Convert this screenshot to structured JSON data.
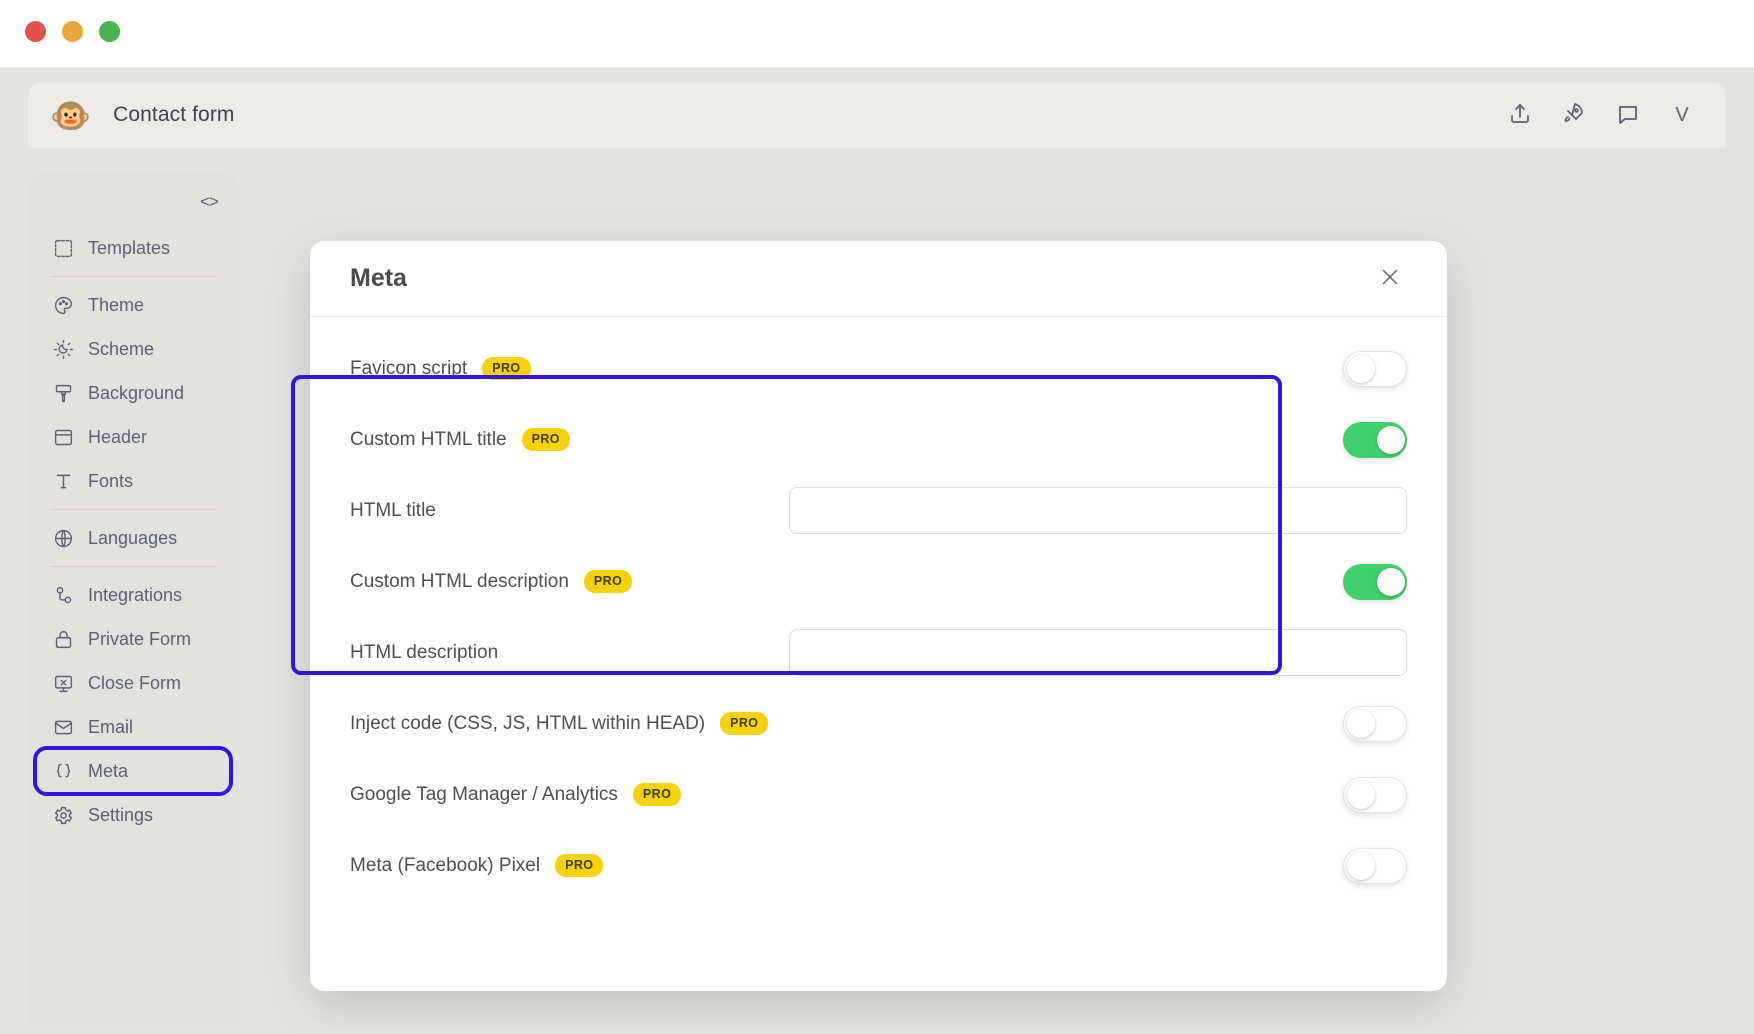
{
  "window": {
    "traffic_lights": [
      "close",
      "minimize",
      "zoom"
    ]
  },
  "topbar": {
    "logo_glyph": "🐵",
    "title": "Contact form",
    "actions": [
      {
        "name": "share-upload",
        "icon": "upload-icon"
      },
      {
        "name": "publish",
        "icon": "rocket-icon"
      },
      {
        "name": "comments",
        "icon": "chat-bubble-icon"
      }
    ],
    "avatar_initial": "V"
  },
  "sidebar": {
    "code_toggle": "<>",
    "items": [
      {
        "label": "Templates",
        "icon": "templates-icon",
        "divider_after": true,
        "selected": false
      },
      {
        "label": "Theme",
        "icon": "palette-icon",
        "divider_after": false,
        "selected": false
      },
      {
        "label": "Scheme",
        "icon": "sun-moon-icon",
        "divider_after": false,
        "selected": false
      },
      {
        "label": "Background",
        "icon": "paint-brush-icon",
        "divider_after": false,
        "selected": false
      },
      {
        "label": "Header",
        "icon": "layout-icon",
        "divider_after": false,
        "selected": false
      },
      {
        "label": "Fonts",
        "icon": "text-t-icon",
        "divider_after": true,
        "selected": false
      },
      {
        "label": "Languages",
        "icon": "globe-icon",
        "divider_after": true,
        "selected": false
      },
      {
        "label": "Integrations",
        "icon": "nodes-icon",
        "divider_after": false,
        "selected": false
      },
      {
        "label": "Private Form",
        "icon": "lock-icon",
        "divider_after": false,
        "selected": false
      },
      {
        "label": "Close Form",
        "icon": "monitor-x-icon",
        "divider_after": false,
        "selected": false
      },
      {
        "label": "Email",
        "icon": "envelope-icon",
        "divider_after": false,
        "selected": false
      },
      {
        "label": "Meta",
        "icon": "curly-braces-icon",
        "divider_after": false,
        "selected": true
      },
      {
        "label": "Settings",
        "icon": "gear-icon",
        "divider_after": false,
        "selected": false
      }
    ]
  },
  "modal": {
    "title": "Meta",
    "close_glyph": "×",
    "rows": [
      {
        "label": "Favicon script",
        "pro": "PRO",
        "control": "toggle",
        "toggle_on": false
      },
      {
        "label": "Custom HTML title",
        "pro": "PRO",
        "control": "toggle",
        "toggle_on": true
      },
      {
        "label": "HTML title",
        "pro": "",
        "control": "input",
        "value": "",
        "placeholder": ""
      },
      {
        "label": "Custom HTML description",
        "pro": "PRO",
        "control": "toggle",
        "toggle_on": true
      },
      {
        "label": "HTML description",
        "pro": "",
        "control": "input",
        "value": "",
        "placeholder": ""
      },
      {
        "label": "Inject code (CSS, JS, HTML within HEAD)",
        "pro": "PRO",
        "control": "toggle",
        "toggle_on": false
      },
      {
        "label": "Google Tag Manager / Analytics",
        "pro": "PRO",
        "control": "toggle",
        "toggle_on": false
      },
      {
        "label": "Meta (Facebook) Pixel",
        "pro": "PRO",
        "control": "toggle",
        "toggle_on": false
      }
    ]
  },
  "colors": {
    "annotation": "#3415e0",
    "toggle_on": "#3ed06a",
    "pro_badge": "#f5d20c",
    "app_background": "#e6e4e1",
    "accent_button": "#4a5aa8"
  }
}
